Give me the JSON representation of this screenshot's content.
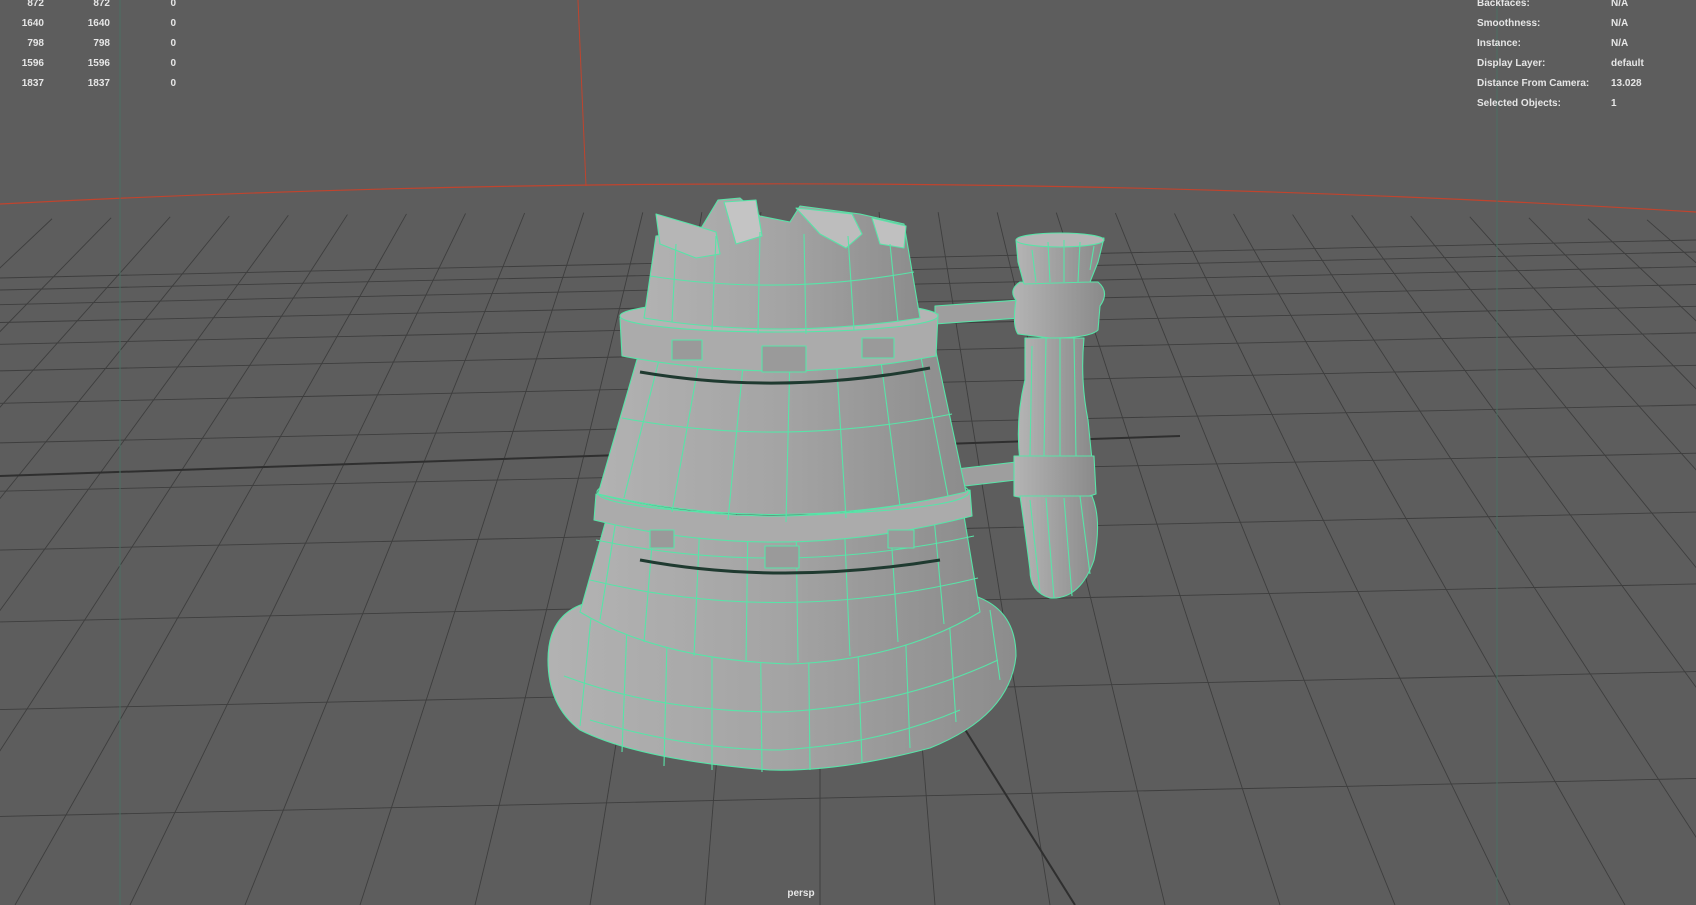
{
  "viewport": {
    "camera_label": "persp",
    "colors": {
      "background": "#5d5d5d",
      "grid": "#3e3e3e",
      "horizon": "#c0442e",
      "wireframe": "#58e4a8",
      "mesh_fill": "#a2a2a2"
    }
  },
  "poly_stats": {
    "rows": [
      [
        "872",
        "872",
        "0"
      ],
      [
        "1640",
        "1640",
        "0"
      ],
      [
        "798",
        "798",
        "0"
      ],
      [
        "1596",
        "1596",
        "0"
      ],
      [
        "1837",
        "1837",
        "0"
      ]
    ]
  },
  "object_info": {
    "rows": [
      {
        "label": "Backfaces:",
        "value": "N/A"
      },
      {
        "label": "Smoothness:",
        "value": "N/A"
      },
      {
        "label": "Instance:",
        "value": "N/A"
      },
      {
        "label": "Display Layer:",
        "value": "default"
      },
      {
        "label": "Distance From Camera:",
        "value": "13.028"
      },
      {
        "label": "Selected Objects:",
        "value": "1"
      }
    ]
  },
  "selected_object": {
    "icon": "tankard-mesh-icon"
  }
}
